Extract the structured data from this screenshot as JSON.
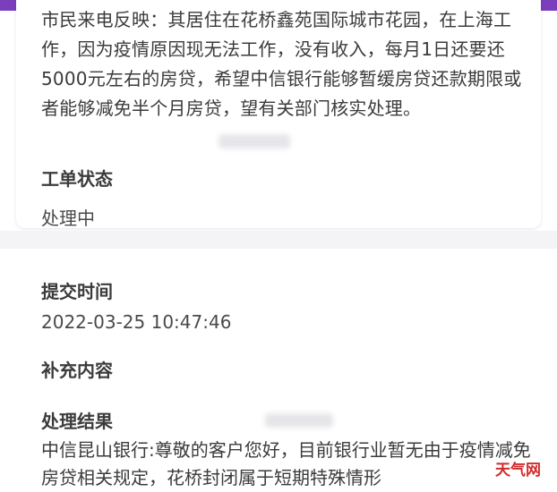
{
  "complaint": {
    "text": "市民来电反映：其居住在花桥鑫苑国际城市花园，在上海工作，因为疫情原因现无法工作，没有收入，每月1日还要还5000元左右的房贷，希望中信银行能够暂缓房贷还款期限或者能够减免半个月房贷，望有关部门核实处理。"
  },
  "order_status": {
    "label": "工单状态",
    "value": "处理中"
  },
  "submit_time": {
    "label": "提交时间",
    "value": "2022-03-25 10:47:46"
  },
  "supplement": {
    "label": "补充内容"
  },
  "result": {
    "label": "处理结果",
    "text": "中信昆山银行:尊敬的客户您好，目前银行业暂无由于疫情减免房贷相关规定，花桥封闭属于短期特殊情形"
  },
  "watermark": {
    "text": "天气网"
  },
  "colors": {
    "accent_bar": "#7b3fbe",
    "watermark": "#d22b2b"
  }
}
